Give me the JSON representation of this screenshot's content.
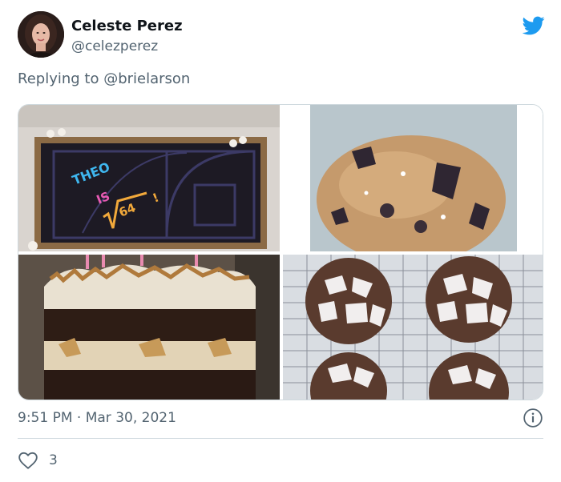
{
  "author": {
    "display_name": "Celeste Perez",
    "handle": "@celezperez"
  },
  "reply": {
    "prefix": "Replying to ",
    "mention": "@brielarson"
  },
  "media": {
    "count": 4,
    "images": [
      {
        "subject": "cake-theo-is-sqrt-64",
        "text_lines": [
          "THEO",
          "IS",
          "64",
          "!"
        ]
      },
      {
        "subject": "chocolate-chunk-cookie"
      },
      {
        "subject": "smores-layer-cake"
      },
      {
        "subject": "crinkle-cookies-on-rack"
      }
    ]
  },
  "meta": {
    "time": "9:51 PM",
    "separator": " · ",
    "date": "Mar 30, 2021"
  },
  "engagement": {
    "likes": "3"
  },
  "colors": {
    "twitter_blue": "#1d9bf0",
    "muted_text": "#536471",
    "border": "#cfd9de"
  },
  "icons": {
    "brand": "twitter-bird-icon",
    "info": "info-icon",
    "like": "heart-icon"
  }
}
